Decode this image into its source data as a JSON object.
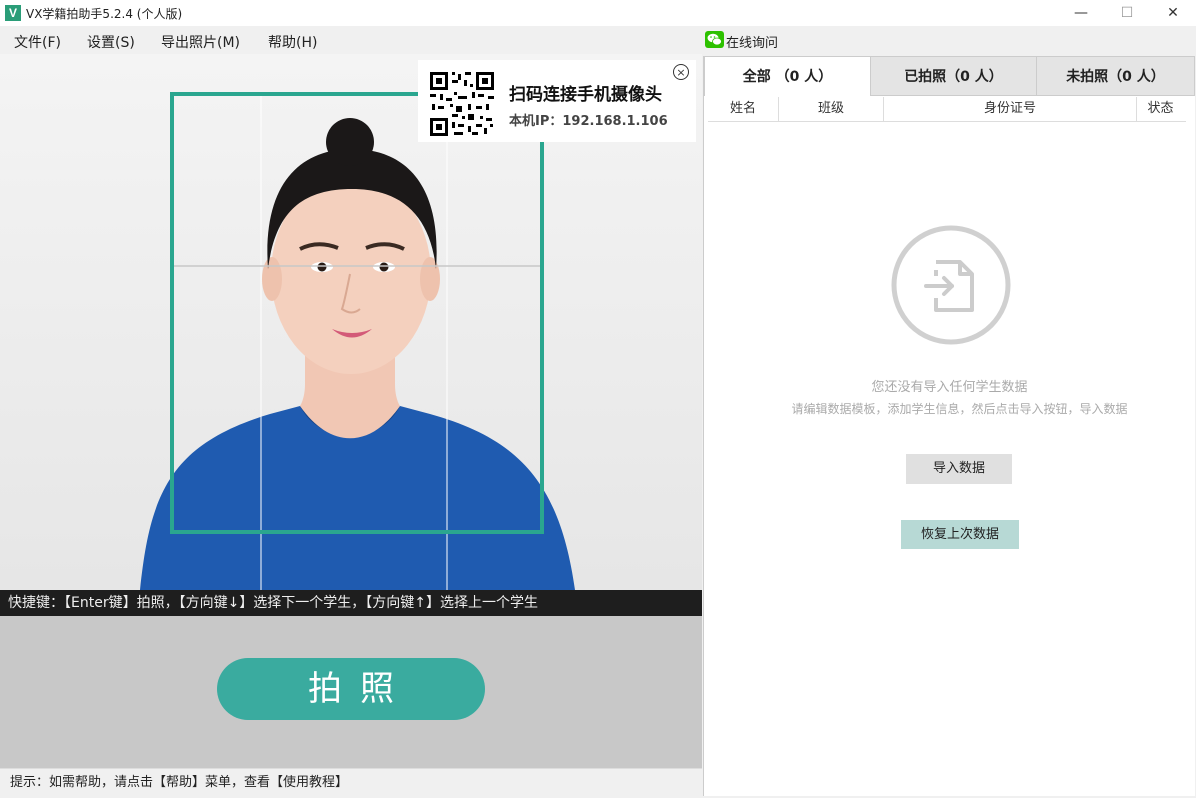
{
  "window": {
    "app_logo": "V",
    "title": "VX学籍拍助手5.2.4 (个人版)",
    "controls": {
      "minimize": "—",
      "maximize": "☐",
      "close": "✕"
    }
  },
  "menu": {
    "items": [
      {
        "label": "文件(F)"
      },
      {
        "label": "设置(S)"
      },
      {
        "label": "导出照片(M)"
      },
      {
        "label": "帮助(H)"
      }
    ],
    "online_ask": "在线询问"
  },
  "camera": {
    "qr": {
      "title": "扫码连接手机摄像头",
      "ip_label": "本机IP：192.168.1.106",
      "close": "×"
    },
    "shortcut_tip": "快捷键：【Enter键】拍照，【方向键↓】选择下一个学生，【方向键↑】选择上一个学生",
    "shoot_label": "拍照",
    "frame_color": "#2aa68f"
  },
  "status": {
    "hint": "提示：如需帮助，请点击【帮助】菜单，查看【使用教程】"
  },
  "panel": {
    "tabs": [
      {
        "label": "全部 （0 人）"
      },
      {
        "label": "已拍照（0 人）"
      },
      {
        "label": "未拍照（0 人）"
      }
    ],
    "columns": [
      "姓名",
      "班级",
      "身份证号",
      "状态"
    ],
    "empty": {
      "icon": "file-import-icon",
      "title": "您还没有导入任何学生数据",
      "desc": "请编辑数据模板，添加学生信息，然后点击导入按钮，导入数据"
    },
    "import_label": "导入数据",
    "restore_label": "恢复上次数据"
  }
}
